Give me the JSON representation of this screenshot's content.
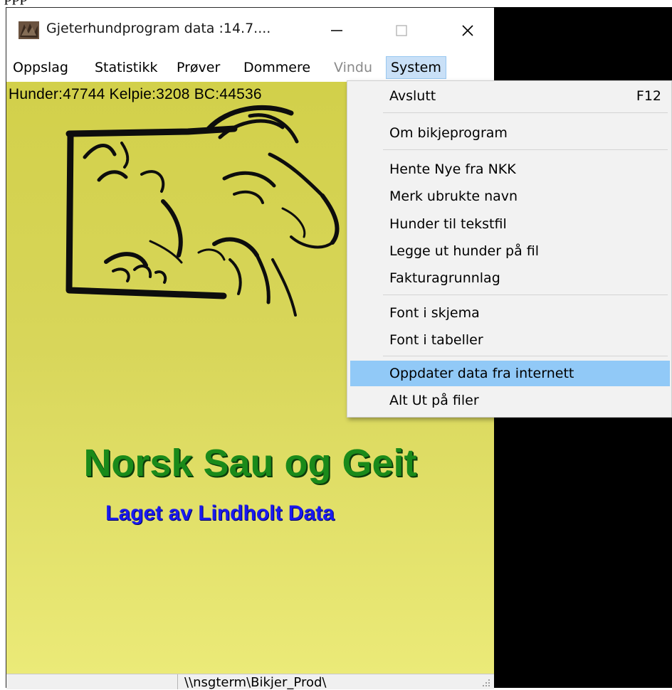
{
  "clipped_top_text": "ppp",
  "window": {
    "title": "Gjeterhundprogram data :14.7....",
    "controls": {
      "minimize": "—",
      "maximize": "☐",
      "close": "✕"
    }
  },
  "menubar": {
    "items": [
      {
        "label": "Oppslag",
        "state": "normal"
      },
      {
        "label": "Statistikk",
        "state": "normal"
      },
      {
        "label": "Prøver",
        "state": "normal"
      },
      {
        "label": "Dommere",
        "state": "normal"
      },
      {
        "label": "Vindu",
        "state": "disabled"
      },
      {
        "label": "System",
        "state": "active"
      }
    ]
  },
  "content": {
    "counts": "Hunder:47744 Kelpie:3208  BC:44536",
    "title": "Norsk Sau og Geit",
    "subtitle": "Laget av Lindholt Data",
    "background_colors": [
      "#d2d04a",
      "#ebea78"
    ]
  },
  "statusbar": {
    "path": "\\\\nsgterm\\Bikjer_Prod\\"
  },
  "system_menu": {
    "items": [
      {
        "label": "Avslutt",
        "shortcut": "F12"
      },
      {
        "label": "Om bikjeprogram"
      },
      {
        "label": "Hente Nye fra NKK"
      },
      {
        "label": "Merk ubrukte navn"
      },
      {
        "label": "Hunder til tekstfil"
      },
      {
        "label": "Legge ut hunder på fil"
      },
      {
        "label": "Fakturagrunnlag"
      },
      {
        "label": "Font i skjema"
      },
      {
        "label": "Font i tabeller"
      },
      {
        "label": "Oppdater data fra internett",
        "highlighted": true
      },
      {
        "label": "Alt Ut på filer"
      }
    ],
    "highlight_color": "#91c9f7"
  }
}
